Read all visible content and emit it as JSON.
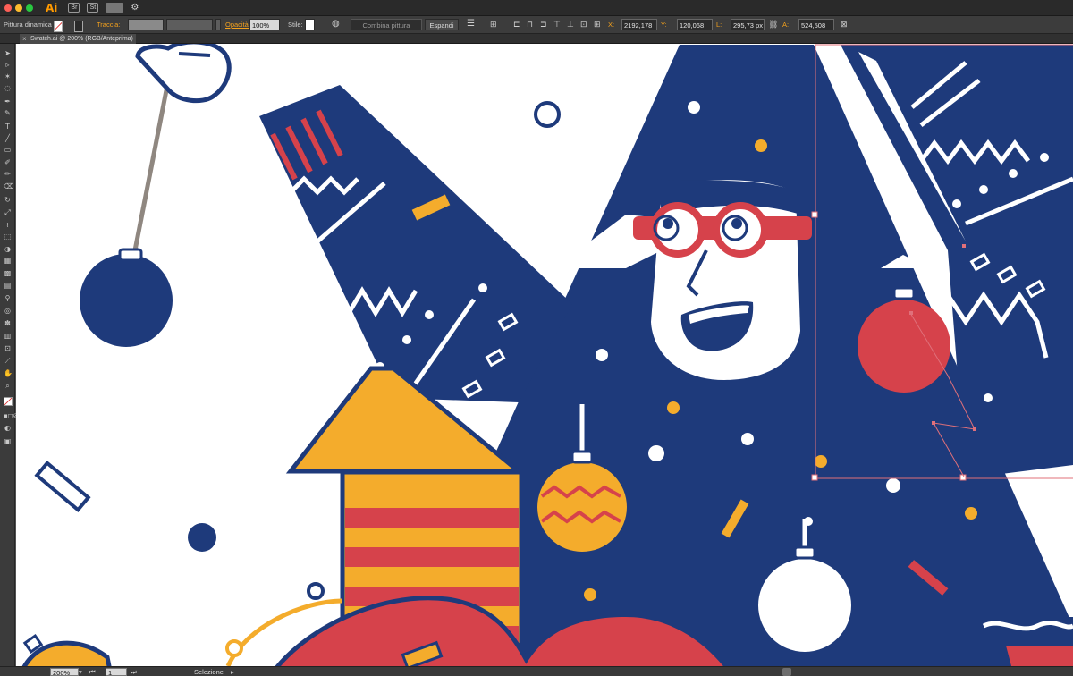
{
  "app": {
    "icon_text": "Ai",
    "icons": [
      "illustrator-logo",
      "bridge-icon",
      "stock-icon",
      "workspace-switcher-icon",
      "gpu-performance-icon"
    ],
    "bridge_label": "Br",
    "stock_label": "St"
  },
  "control_bar": {
    "selection_kind": "Pittura dinamica",
    "stroke_label": "Traccia:",
    "opacity_label": "Opacità:",
    "opacity_value": "100%",
    "style_label": "Stile:",
    "merge_live_paint": "Combina pittura dinamica",
    "expand_button": "Espandi",
    "x_label": "X:",
    "x_value": "2192,178 px",
    "y_label": "Y:",
    "y_value": "120,068 px",
    "w_label": "L:",
    "w_value": "295,73 px",
    "h_label": "A:",
    "h_value": "524,508 px"
  },
  "document": {
    "tab_title": "Swatch.ai @ 200% (RGB/Anteprima)",
    "close_glyph": "×"
  },
  "tools": [
    "selection-tool",
    "direct-selection-tool",
    "magic-wand-tool",
    "lasso-tool",
    "pen-tool",
    "curvature-tool",
    "type-tool",
    "line-tool",
    "rectangle-tool",
    "paintbrush-tool",
    "pencil-tool",
    "eraser-tool",
    "rotate-tool",
    "scale-tool",
    "width-tool",
    "free-transform-tool",
    "shape-builder-tool",
    "perspective-grid-tool",
    "mesh-tool",
    "gradient-tool",
    "eyedropper-tool",
    "blend-tool",
    "symbol-sprayer-tool",
    "column-graph-tool",
    "artboard-tool",
    "slice-tool",
    "hand-tool",
    "zoom-tool",
    "fill-stroke-swatch",
    "drawing-modes",
    "screen-mode"
  ],
  "status_bar": {
    "zoom": "200%",
    "artboard_number": "1",
    "current_tool": "Selezione"
  },
  "colors": {
    "navy": "#1e3a7b",
    "red": "#d6424b",
    "yellow": "#f4ac2c",
    "white": "#ffffff",
    "selection": "#e0707a",
    "ui_dark": "#3c3c3c",
    "ui_accent": "#f3a11d"
  }
}
